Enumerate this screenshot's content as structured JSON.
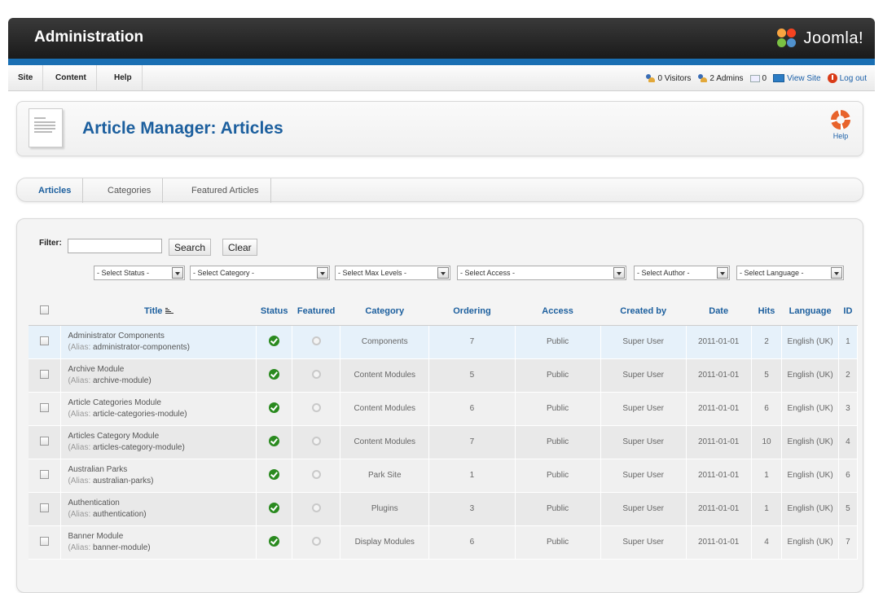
{
  "app": {
    "title": "Administration",
    "brand": "Joomla!"
  },
  "menu": [
    "Site",
    "Content",
    "Help"
  ],
  "status": {
    "visitors": "0 Visitors",
    "admins": "2 Admins",
    "messages": "0",
    "view_site": "View Site",
    "logout": "Log out"
  },
  "header": {
    "title": "Article Manager: Articles",
    "help": "Help"
  },
  "tabs": [
    "Articles",
    "Categories",
    "Featured Articles"
  ],
  "filter": {
    "label": "Filter:",
    "value": "",
    "search": "Search",
    "clear": "Clear",
    "selects": [
      "- Select Status -",
      "- Select Category -",
      "- Select Max Levels -",
      "- Select Access -",
      "- Select Author -",
      "- Select Language -"
    ]
  },
  "table": {
    "columns": [
      "Title",
      "Status",
      "Featured",
      "Category",
      "Ordering",
      "Access",
      "Created by",
      "Date",
      "Hits",
      "Language",
      "ID"
    ],
    "alias_label": "(Alias: ",
    "rows": [
      {
        "title": "Administrator Components",
        "alias": "administrator-components",
        "category": "Components",
        "ordering": "7",
        "access": "Public",
        "created_by": "Super User",
        "date": "2011-01-01",
        "hits": "2",
        "language": "English (UK)",
        "id": "1"
      },
      {
        "title": "Archive Module",
        "alias": "archive-module",
        "category": "Content Modules",
        "ordering": "5",
        "access": "Public",
        "created_by": "Super User",
        "date": "2011-01-01",
        "hits": "5",
        "language": "English (UK)",
        "id": "2"
      },
      {
        "title": "Article Categories Module",
        "alias": "article-categories-module",
        "category": "Content Modules",
        "ordering": "6",
        "access": "Public",
        "created_by": "Super User",
        "date": "2011-01-01",
        "hits": "6",
        "language": "English (UK)",
        "id": "3"
      },
      {
        "title": "Articles Category Module",
        "alias": "articles-category-module",
        "category": "Content Modules",
        "ordering": "7",
        "access": "Public",
        "created_by": "Super User",
        "date": "2011-01-01",
        "hits": "10",
        "language": "English (UK)",
        "id": "4"
      },
      {
        "title": "Australian Parks",
        "alias": "australian-parks",
        "category": "Park Site",
        "ordering": "1",
        "access": "Public",
        "created_by": "Super User",
        "date": "2011-01-01",
        "hits": "1",
        "language": "English (UK)",
        "id": "6"
      },
      {
        "title": "Authentication",
        "alias": "authentication",
        "category": "Plugins",
        "ordering": "3",
        "access": "Public",
        "created_by": "Super User",
        "date": "2011-01-01",
        "hits": "1",
        "language": "English (UK)",
        "id": "5"
      },
      {
        "title": "Banner Module",
        "alias": "banner-module",
        "category": "Display Modules",
        "ordering": "6",
        "access": "Public",
        "created_by": "Super User",
        "date": "2011-01-01",
        "hits": "4",
        "language": "English (UK)",
        "id": "7"
      }
    ]
  }
}
